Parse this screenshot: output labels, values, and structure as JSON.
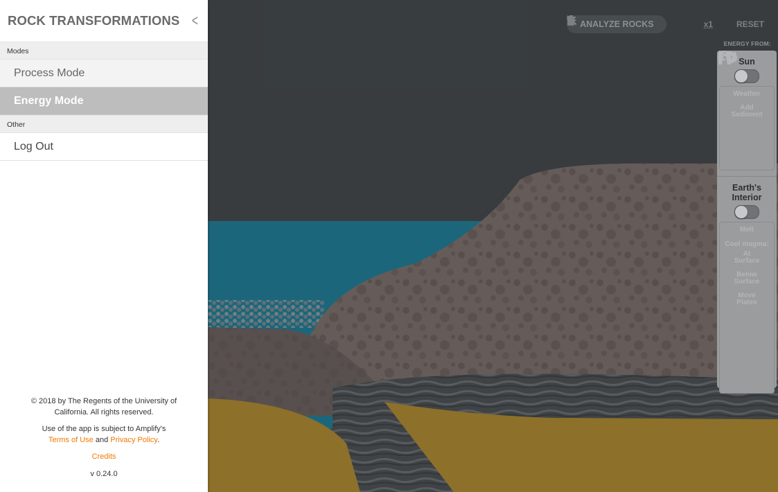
{
  "app": {
    "title": "ROCK TRANSFORMATIONS"
  },
  "sidebar": {
    "sections": [
      {
        "label": "Modes",
        "items": [
          {
            "label": "Process Mode",
            "active": false
          },
          {
            "label": "Energy Mode",
            "active": true
          }
        ]
      },
      {
        "label": "Other",
        "items": [
          {
            "label": "Log Out"
          }
        ]
      }
    ],
    "footer": {
      "copyright": "© 2018 by The Regents of the University of California. All rights reserved.",
      "use_prefix": "Use of the app is subject to Amplify's",
      "terms_label": "Terms of Use",
      "and_text": "and",
      "privacy_label": "Privacy Policy",
      "period": ".",
      "credits_label": "Credits",
      "version": "v 0.24.0"
    }
  },
  "toolbar": {
    "analyze_label": "ANALYZE ROCKS",
    "speed_label": "x1",
    "reset_label": "RESET"
  },
  "energy_panel": {
    "heading": "ENERGY FROM:",
    "sun": {
      "title": "Sun",
      "toggle_on": false,
      "actions": [
        {
          "label_1": "Weather",
          "icon": "cloud-rain-icon"
        },
        {
          "label_1": "Add",
          "label_2": "Sediment",
          "icon": "sediment-icon"
        }
      ]
    },
    "interior": {
      "title_1": "Earth's",
      "title_2": "Interior",
      "toggle_on": false,
      "melt_label": "Melt",
      "cool_label": "Cool magma:",
      "at_1": "At",
      "at_2": "Surface",
      "below_1": "Below",
      "below_2": "Surface",
      "move_1": "Move",
      "move_2": "Plates"
    }
  },
  "colors": {
    "accent": "#f07800",
    "sidebar_active": "#bdbdbd",
    "sky": "#3d4245",
    "water": "#1f6f86",
    "rock": "#6e6462",
    "sand": "#9a7a2e"
  }
}
